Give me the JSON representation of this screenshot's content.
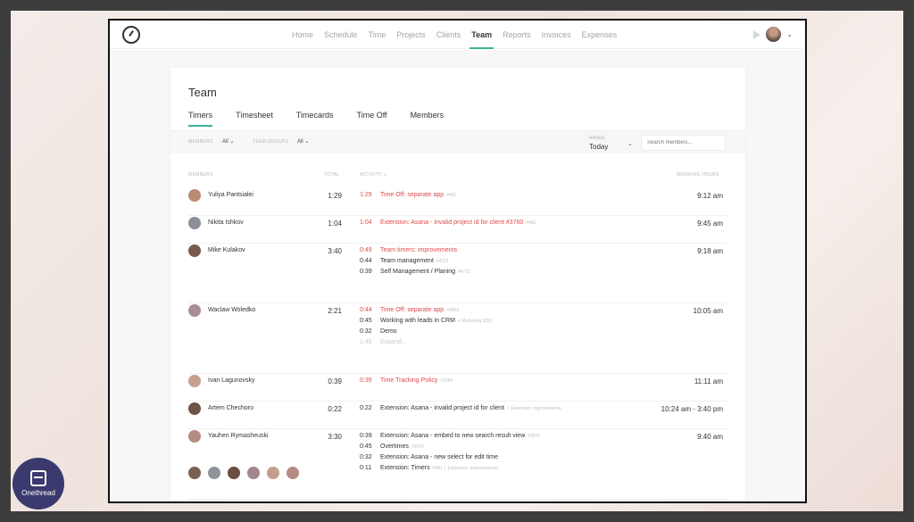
{
  "nav": [
    "Home",
    "Schedule",
    "Time",
    "Projects",
    "Clients",
    "Team",
    "Reports",
    "Invoices",
    "Expenses"
  ],
  "active_nav": "Team",
  "page_title": "Team",
  "tabs": [
    "Timers",
    "Timesheet",
    "Timecards",
    "Time Off",
    "Members"
  ],
  "active_tab": "Timers",
  "filters": {
    "members_label": "MEMBERS",
    "members_value": "All",
    "team_groups_label": "TEAM GROUPS",
    "team_groups_value": "All",
    "range_label": "RANGE",
    "range_value": "Today",
    "search_placeholder": "Search members..."
  },
  "columns": {
    "members": "MEMBERS",
    "total": "TOTAL",
    "activity": "ACTIVITY",
    "working_hours": "WORKING HOURS"
  },
  "rows": [
    {
      "name": "Yuliya Pantsialei",
      "total": "1:29",
      "hours": "9:12 am",
      "avatar_color": "#b98b74",
      "activities": [
        {
          "dur": "1:29",
          "text": "Time Off: separate app",
          "tag": "#481",
          "style": "red"
        }
      ]
    },
    {
      "name": "Nikita Ishkov",
      "total": "1:04",
      "hours": "9:45 am",
      "avatar_color": "#8a8f98",
      "activities": [
        {
          "dur": "1:04",
          "text": "Extension: Asana - invalid project id for client #3760",
          "tag": "#481",
          "style": "red"
        }
      ]
    },
    {
      "name": "Mike Kulakov",
      "total": "3:40",
      "hours": "9:18 am",
      "avatar_color": "#7a5a4a",
      "activities": [
        {
          "dur": "0:49",
          "text": "Team timers: improvements",
          "tag": "",
          "style": "red"
        },
        {
          "dur": "0:44",
          "text": "Team management",
          "tag": "#4721",
          "style": "norm"
        },
        {
          "dur": "0:39",
          "text": "Self Management / Planing",
          "tag": "#4721",
          "style": "norm"
        }
      ]
    },
    {
      "name": "Waclaw Woledko",
      "total": "2:21",
      "hours": "10:05 am",
      "avatar_color": "#a88c9a",
      "activities": [
        {
          "dur": "0:44",
          "text": "Time Off: separate app",
          "tag": "#4802",
          "style": "red"
        },
        {
          "dur": "0:45",
          "text": "Working with leads in CRM",
          "tag": "< Marketing 2020",
          "style": "norm"
        },
        {
          "dur": "0:32",
          "text": "Demo",
          "tag": "",
          "style": "norm"
        },
        {
          "dur": "1:45",
          "text": "Expand...",
          "tag": "",
          "style": "grey"
        }
      ]
    },
    {
      "name": "Ivan Lagunovsky",
      "total": "0:39",
      "hours": "11:11 am",
      "avatar_color": "#c6a08e",
      "activities": [
        {
          "dur": "0:39",
          "text": "Time Tracking Policy",
          "tag": "#3384",
          "style": "red"
        }
      ]
    },
    {
      "name": "Artem Chechoro",
      "total": "0:22",
      "hours": "10:24 am - 3:40 pm",
      "avatar_color": "#6e5446",
      "activities": [
        {
          "dur": "0:22",
          "text": "Extension: Asana - invalid project id for client",
          "tag": "< Extension: Improvements",
          "style": "norm"
        }
      ]
    },
    {
      "name": "Yauhen Rymasheuski",
      "total": "3:30",
      "hours": "9:40 am",
      "avatar_color": "#b48a82",
      "activities": [
        {
          "dur": "0:39",
          "text": "Extension: Asana - embed to new search result view",
          "tag": "#3670",
          "style": "norm"
        },
        {
          "dur": "0:45",
          "text": "Overtimes",
          "tag": "#3670",
          "style": "norm"
        },
        {
          "dur": "0:32",
          "text": "Extension: Asana - new select for edit time",
          "tag": "",
          "style": "norm"
        },
        {
          "dur": "0:11",
          "text": "Extension: Timers",
          "tag": "#481 < Extension: Improvements",
          "style": "norm"
        }
      ]
    }
  ],
  "bottom_avatar_colors": [
    "#7a6050",
    "#8e939c",
    "#6a4e40",
    "#a3868e",
    "#c49e8c",
    "#b58c84"
  ],
  "badge_text": "Onethread",
  "accent": "#3fb39a",
  "red": "#e04a4a"
}
